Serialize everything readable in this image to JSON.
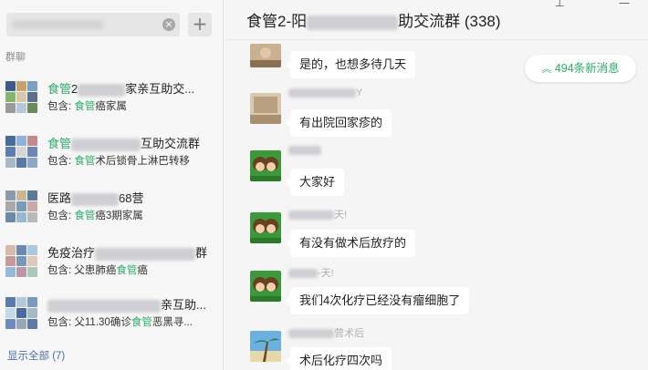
{
  "search": {
    "clear_icon": "×",
    "add_icon": "+"
  },
  "sidebar": {
    "section_label": "群聊",
    "groups": [
      {
        "title_pre": "",
        "title_hl": "食管",
        "title_post_a": "2",
        "title_post_b": "家亲互助交...",
        "sub_pre": "包含: ",
        "sub_hl": "食管",
        "sub_post": "癌家属"
      },
      {
        "title_pre": "",
        "title_hl": "食管",
        "title_post_a": "",
        "title_post_b": "互助交流群",
        "sub_pre": "包含: ",
        "sub_hl": "食管",
        "sub_post": "术后锁骨上淋巴转移"
      },
      {
        "title_pre": "医路",
        "title_hl": "",
        "title_post_a": "",
        "title_post_b": "68营",
        "sub_pre": "包含: ",
        "sub_hl": "食管",
        "sub_post": "癌3期家属"
      },
      {
        "title_pre": "免疫治疗",
        "title_hl": "",
        "title_post_a": "",
        "title_post_b": "群",
        "sub_pre": "包含: 父患肺癌",
        "sub_hl": "食管",
        "sub_post": "癌"
      },
      {
        "title_pre": "",
        "title_hl": "",
        "title_post_a": "",
        "title_post_b": "亲互助...",
        "sub_pre": "包含: 父11.30确诊",
        "sub_hl": "食管",
        "sub_post": "恶黑寻..."
      }
    ],
    "show_all": "显示全部 (7)"
  },
  "chat": {
    "title_pre": "食管2-阳",
    "title_post": "助交流群 (338)",
    "new_messages": "494条新消息",
    "new_messages_icon": "double-chevron-up-icon",
    "messages": [
      {
        "name": "",
        "text": "是的，也想多待几天"
      },
      {
        "name": "Y",
        "text": "有出院回家疹的"
      },
      {
        "name": "",
        "text": "大家好"
      },
      {
        "name": "天!",
        "text": "有没有做术后放疗的"
      },
      {
        "name": "-天!",
        "text": "我们4次化疗已经没有瘤细胞了"
      },
      {
        "name": "营术后",
        "text": "术后化疗四次吗"
      }
    ]
  },
  "colors": {
    "accent": "#2aae67",
    "link": "#4b6ea8"
  }
}
